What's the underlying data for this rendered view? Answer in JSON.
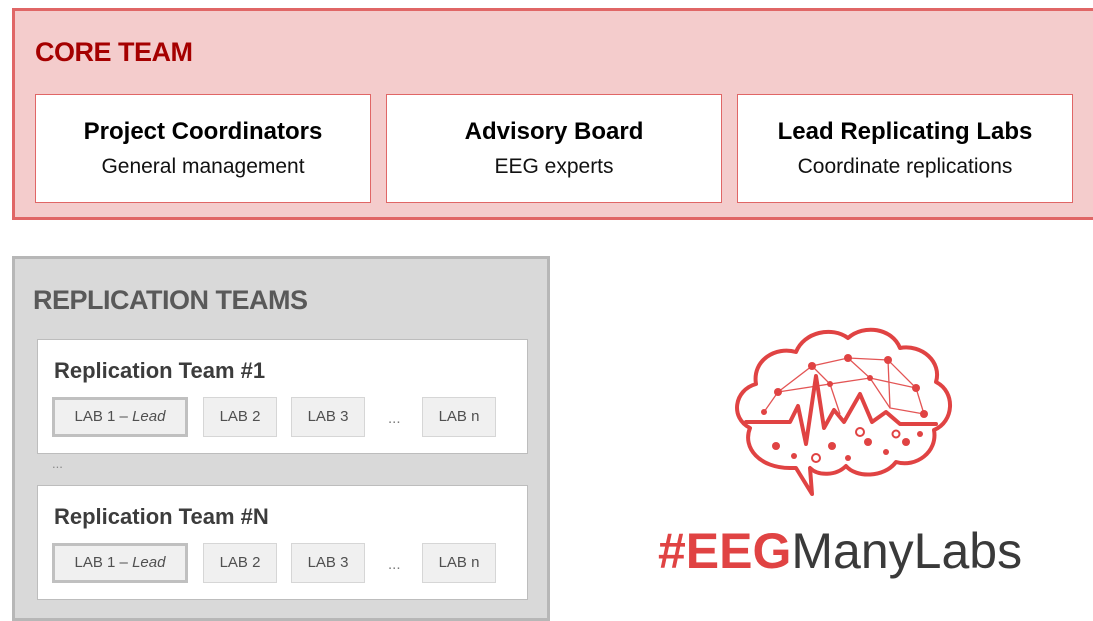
{
  "core_team": {
    "title": "CORE TEAM",
    "boxes": [
      {
        "name": "Project Coordinators",
        "desc": "General management"
      },
      {
        "name": "Advisory Board",
        "desc": "EEG experts"
      },
      {
        "name": "Lead Replicating Labs",
        "desc": "Coordinate replications"
      }
    ]
  },
  "replication_teams": {
    "title": "REPLICATION TEAMS",
    "gap_ellipsis": "...",
    "teams": [
      {
        "name": "Replication Team #1",
        "lead_lab": "LAB 1 – ",
        "lead_suffix": "Lead",
        "labs": [
          "LAB 2",
          "LAB 3"
        ],
        "ellipsis": "...",
        "last_lab": "LAB n"
      },
      {
        "name": "Replication Team #N",
        "lead_lab": "LAB 1 – ",
        "lead_suffix": "Lead",
        "labs": [
          "LAB 2",
          "LAB 3"
        ],
        "ellipsis": "...",
        "last_lab": "LAB n"
      }
    ]
  },
  "logo": {
    "icon": "brain-network-eeg-icon",
    "hash_part": "#EEG",
    "rest_part": "ManyLabs"
  },
  "colors": {
    "core_fill": "#f4cccc",
    "core_border": "#e06666",
    "core_title": "#a50000",
    "rep_fill": "#d9d9d9",
    "rep_title": "#595959",
    "logo_red": "#e04343"
  }
}
